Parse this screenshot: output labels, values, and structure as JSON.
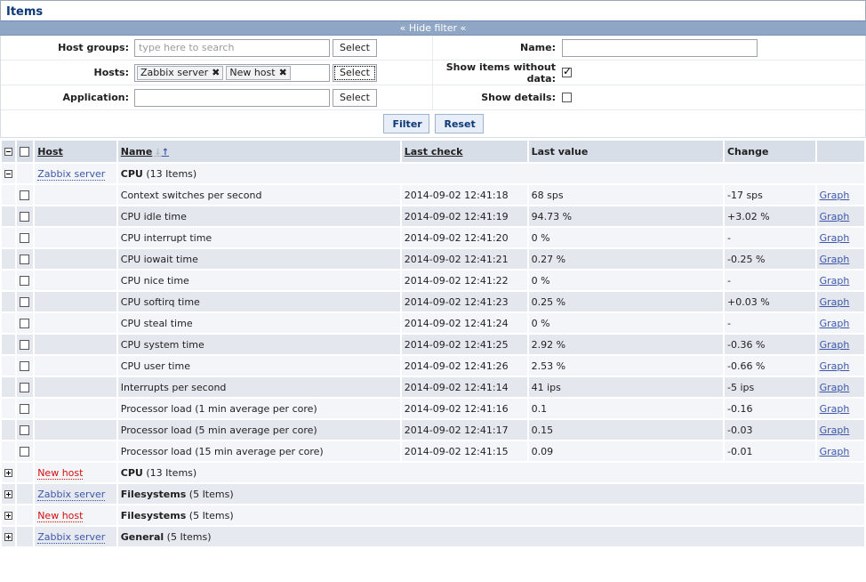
{
  "page": {
    "title": "Items"
  },
  "filter": {
    "toggle_label": "Hide filter",
    "host_groups": {
      "label": "Host groups:",
      "placeholder": "type here to search"
    },
    "hosts": {
      "label": "Hosts:",
      "tags": [
        "Zabbix server",
        "New host"
      ]
    },
    "application": {
      "label": "Application:",
      "value": ""
    },
    "select_label": "Select",
    "name": {
      "label": "Name:",
      "value": ""
    },
    "show_without_data": {
      "label": "Show items without data:",
      "checked": true
    },
    "show_details": {
      "label": "Show details:",
      "checked": false
    },
    "filter_button": "Filter",
    "reset_button": "Reset"
  },
  "table": {
    "columns": {
      "host": "Host",
      "name": "Name",
      "last_check": "Last check",
      "last_value": "Last value",
      "change": "Change"
    },
    "expanded_group": {
      "host": "Zabbix server",
      "name": "CPU",
      "count": "(13 Items)"
    },
    "rows": [
      {
        "name": "Context switches per second",
        "last_check": "2014-09-02 12:41:18",
        "last_value": "68 sps",
        "change": "-17 sps",
        "action": "Graph"
      },
      {
        "name": "CPU idle time",
        "last_check": "2014-09-02 12:41:19",
        "last_value": "94.73 %",
        "change": "+3.02 %",
        "action": "Graph"
      },
      {
        "name": "CPU interrupt time",
        "last_check": "2014-09-02 12:41:20",
        "last_value": "0 %",
        "change": "-",
        "action": "Graph"
      },
      {
        "name": "CPU iowait time",
        "last_check": "2014-09-02 12:41:21",
        "last_value": "0.27 %",
        "change": "-0.25 %",
        "action": "Graph"
      },
      {
        "name": "CPU nice time",
        "last_check": "2014-09-02 12:41:22",
        "last_value": "0 %",
        "change": "-",
        "action": "Graph"
      },
      {
        "name": "CPU softirq time",
        "last_check": "2014-09-02 12:41:23",
        "last_value": "0.25 %",
        "change": "+0.03 %",
        "action": "Graph"
      },
      {
        "name": "CPU steal time",
        "last_check": "2014-09-02 12:41:24",
        "last_value": "0 %",
        "change": "-",
        "action": "Graph"
      },
      {
        "name": "CPU system time",
        "last_check": "2014-09-02 12:41:25",
        "last_value": "2.92 %",
        "change": "-0.36 %",
        "action": "Graph"
      },
      {
        "name": "CPU user time",
        "last_check": "2014-09-02 12:41:26",
        "last_value": "2.53 %",
        "change": "-0.66 %",
        "action": "Graph"
      },
      {
        "name": "Interrupts per second",
        "last_check": "2014-09-02 12:41:14",
        "last_value": "41 ips",
        "change": "-5 ips",
        "action": "Graph"
      },
      {
        "name": "Processor load (1 min average per core)",
        "last_check": "2014-09-02 12:41:16",
        "last_value": "0.1",
        "change": "-0.16",
        "action": "Graph"
      },
      {
        "name": "Processor load (5 min average per core)",
        "last_check": "2014-09-02 12:41:17",
        "last_value": "0.15",
        "change": "-0.03",
        "action": "Graph"
      },
      {
        "name": "Processor load (15 min average per core)",
        "last_check": "2014-09-02 12:41:15",
        "last_value": "0.09",
        "change": "-0.01",
        "action": "Graph"
      }
    ],
    "collapsed_groups": [
      {
        "host": "New host",
        "name": "CPU",
        "count": "(13 Items)"
      },
      {
        "host": "Zabbix server",
        "name": "Filesystems",
        "count": "(5 Items)"
      },
      {
        "host": "New host",
        "name": "Filesystems",
        "count": "(5 Items)"
      },
      {
        "host": "Zabbix server",
        "name": "General",
        "count": "(5 Items)"
      }
    ]
  }
}
